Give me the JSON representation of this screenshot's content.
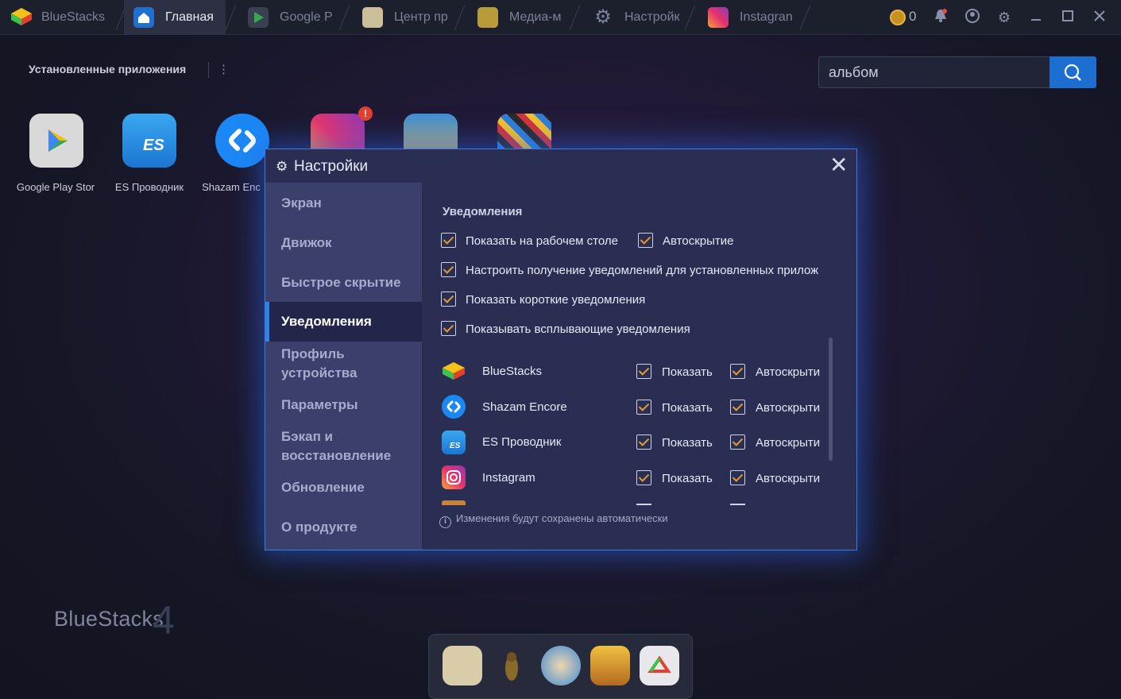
{
  "titlebar": {
    "app_name": "BlueStacks",
    "tabs": [
      {
        "label": "Главная",
        "icon": "home-icon",
        "active": true
      },
      {
        "label": "Google P",
        "icon": "play-store-icon",
        "active": false
      },
      {
        "label": "Центр пр",
        "icon": "app-center-icon",
        "active": false
      },
      {
        "label": "Медиа-м",
        "icon": "media-manager-icon",
        "active": false
      },
      {
        "label": "Настройк",
        "icon": "settings-gear-icon",
        "active": false
      },
      {
        "label": "Instagran",
        "icon": "instagram-icon",
        "active": false
      }
    ],
    "coins": "0"
  },
  "desktop": {
    "installed_title": "Установленные приложения",
    "menu_glyph": "⋮",
    "search": {
      "value": "альбом",
      "placeholder": ""
    },
    "apps": [
      {
        "label": "Google Play Stor",
        "icon": "google-play-icon"
      },
      {
        "label": "ES Проводник",
        "icon": "es-explorer-icon"
      },
      {
        "label": "Shazam Enc",
        "icon": "shazam-icon"
      },
      {
        "label": "",
        "icon": "instagram-icon"
      },
      {
        "label": "",
        "icon": "clash-royale-icon"
      },
      {
        "label": "",
        "icon": "puzzle-game-icon"
      }
    ],
    "instagram_badge": "!",
    "brand": "BlueStacks",
    "brand_version": "4"
  },
  "settings": {
    "title": "Настройки",
    "nav": [
      {
        "label": "Экран",
        "active": false
      },
      {
        "label": "Движок",
        "active": false
      },
      {
        "label": "Быстрое скрытие",
        "active": false
      },
      {
        "label": "Уведомления",
        "active": true
      },
      {
        "label": "Профиль устройства",
        "active": false
      },
      {
        "label": "Параметры",
        "active": false
      },
      {
        "label": "Бэкап и восстановление",
        "active": false
      },
      {
        "label": "Обновление",
        "active": false
      },
      {
        "label": "О продукте",
        "active": false
      }
    ],
    "section_title": "Уведомления",
    "options": {
      "show_on_desktop": "Показать на рабочем столе",
      "autohide": "Автоскрытие",
      "configure_apps": "Настроить получение уведомлений для установленных прилож",
      "short_notifications": "Показать короткие уведомления",
      "popup_notifications": "Показывать всплывающие уведомления"
    },
    "app_rows": [
      {
        "name": "BlueStacks",
        "show": "Показать",
        "autohide": "Автоскрыти",
        "icon": "bluestacks-icon"
      },
      {
        "name": "Shazam Encore",
        "show": "Показать",
        "autohide": "Автоскрыти",
        "icon": "shazam-icon"
      },
      {
        "name": "ES Проводник",
        "show": "Показать",
        "autohide": "Автоскрыти",
        "icon": "es-explorer-icon"
      },
      {
        "name": "Instagram",
        "show": "Показать",
        "autohide": "Автоскрыти",
        "icon": "instagram-icon"
      }
    ],
    "footer_note": "Изменения будут сохранены автоматически",
    "accent_color": "#2f82e8",
    "check_color": "#e29a34"
  }
}
